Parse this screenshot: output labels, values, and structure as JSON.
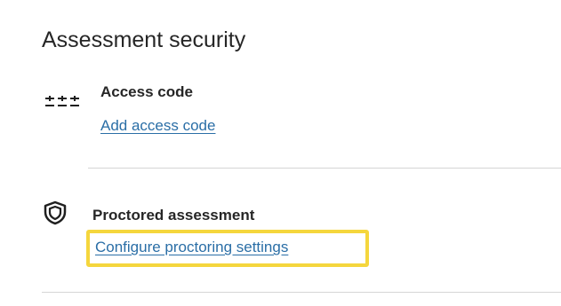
{
  "section": {
    "title": "Assessment security"
  },
  "access_code": {
    "icon": "asterisks-icon",
    "title": "Access code",
    "link": "Add access code"
  },
  "proctoring": {
    "icon": "shield-icon",
    "title": "Proctored assessment",
    "link": "Configure proctoring settings"
  },
  "colors": {
    "text": "#262626",
    "link": "#2a6ea6",
    "focus_outline": "#f5d63d",
    "divider": "#d5d5d5"
  }
}
